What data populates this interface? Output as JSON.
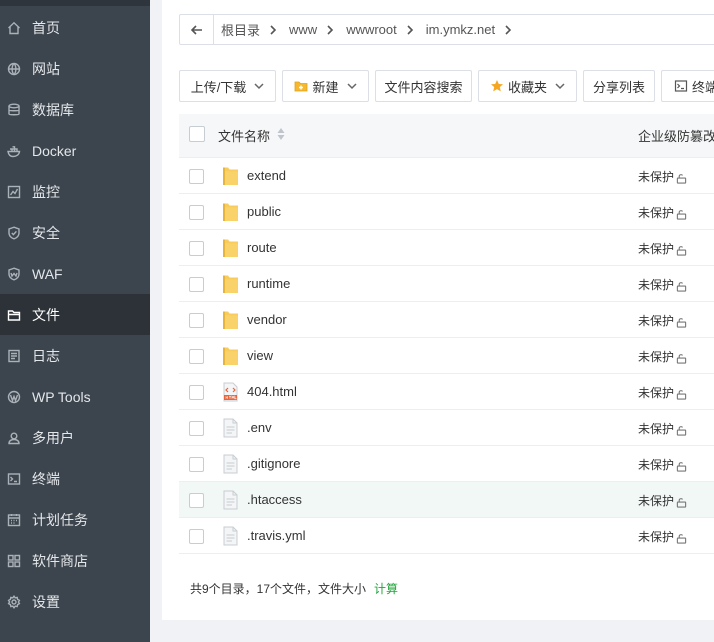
{
  "sidebar": {
    "items": [
      {
        "label": "首页",
        "icon": "home-icon"
      },
      {
        "label": "网站",
        "icon": "globe-icon"
      },
      {
        "label": "数据库",
        "icon": "database-icon"
      },
      {
        "label": "Docker",
        "icon": "docker-icon"
      },
      {
        "label": "监控",
        "icon": "monitor-icon"
      },
      {
        "label": "安全",
        "icon": "shield-icon"
      },
      {
        "label": "WAF",
        "icon": "waf-icon"
      },
      {
        "label": "文件",
        "icon": "folder-icon",
        "active": true
      },
      {
        "label": "日志",
        "icon": "log-icon"
      },
      {
        "label": "WP Tools",
        "icon": "wordpress-icon"
      },
      {
        "label": "多用户",
        "icon": "users-icon"
      },
      {
        "label": "终端",
        "icon": "terminal-icon"
      },
      {
        "label": "计划任务",
        "icon": "calendar-icon"
      },
      {
        "label": "软件商店",
        "icon": "apps-icon"
      },
      {
        "label": "设置",
        "icon": "gear-icon"
      }
    ]
  },
  "breadcrumb": {
    "items": [
      "根目录",
      "www",
      "wwwroot",
      "im.ymkz.net"
    ]
  },
  "toolbar": {
    "upload_label": "上传/下载",
    "new_label": "新建",
    "search_label": "文件内容搜索",
    "favorites_label": "收藏夹",
    "share_label": "分享列表",
    "terminal_label": "终端"
  },
  "table": {
    "col_name": "文件名称",
    "col_protect": "企业级防篡改",
    "rows": [
      {
        "name": "extend",
        "type": "folder",
        "protect": "未保护"
      },
      {
        "name": "public",
        "type": "folder",
        "protect": "未保护"
      },
      {
        "name": "route",
        "type": "folder",
        "protect": "未保护"
      },
      {
        "name": "runtime",
        "type": "folder",
        "protect": "未保护"
      },
      {
        "name": "vendor",
        "type": "folder",
        "protect": "未保护"
      },
      {
        "name": "view",
        "type": "folder",
        "protect": "未保护"
      },
      {
        "name": "404.html",
        "type": "html",
        "protect": "未保护"
      },
      {
        "name": ".env",
        "type": "file",
        "protect": "未保护"
      },
      {
        "name": ".gitignore",
        "type": "file",
        "protect": "未保护"
      },
      {
        "name": ".htaccess",
        "type": "file",
        "protect": "未保护",
        "hover": true
      },
      {
        "name": ".travis.yml",
        "type": "file",
        "protect": "未保护"
      }
    ]
  },
  "footer": {
    "summary": "共9个目录，17个文件，文件大小",
    "calc_label": "计算"
  },
  "colors": {
    "accent": "#20a53a",
    "sidebar_bg": "#3c444d",
    "sidebar_active": "#2c3238"
  }
}
